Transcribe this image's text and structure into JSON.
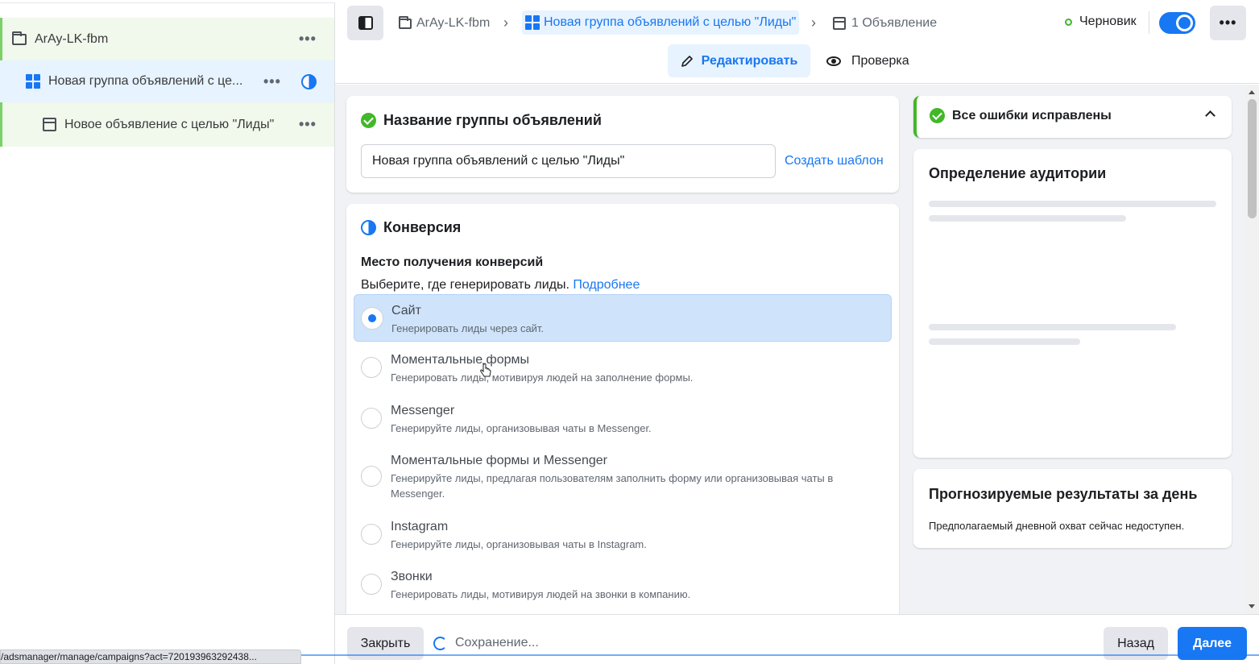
{
  "tree": {
    "campaign": {
      "label": "ArAy-LK-fbm",
      "more": "•••"
    },
    "adset": {
      "label": "Новая группа объявлений с це...",
      "more": "•••"
    },
    "ad": {
      "label": "Новое объявление с целью \"Лиды\"",
      "more": "•••"
    }
  },
  "header": {
    "breadcrumbs": [
      {
        "label": "ArAy-LK-fbm"
      },
      {
        "label": "Новая группа объявлений с целью \"Лиды\""
      },
      {
        "label": "1 Объявление"
      }
    ],
    "status": "Черновик",
    "more": "•••",
    "tabs": {
      "edit": "Редактировать",
      "review": "Проверка"
    }
  },
  "adset_name_card": {
    "title": "Название группы объявлений",
    "input_value": "Новая группа объявлений с целью \"Лиды\"",
    "create_template": "Создать шаблон"
  },
  "conversion_card": {
    "title": "Конверсия",
    "subhead": "Место получения конверсий",
    "subtext": "Выберите, где генерировать лиды.",
    "more_link": "Подробнее",
    "options": [
      {
        "title": "Сайт",
        "desc": "Генерировать лиды через сайт.",
        "selected": true
      },
      {
        "title": "Моментальные формы",
        "desc": "Генерировать лиды, мотивируя людей на заполнение формы.",
        "selected": false
      },
      {
        "title": "Messenger",
        "desc": "Генерируйте лиды, организовывая чаты в Messenger.",
        "selected": false
      },
      {
        "title": "Моментальные формы и Messenger",
        "desc": "Генерируйте лиды, предлагая пользователям заполнить форму или организовывая чаты в Messenger.",
        "selected": false
      },
      {
        "title": "Instagram",
        "desc": "Генерируйте лиды, организовывая чаты в Instagram.",
        "selected": false
      },
      {
        "title": "Звонки",
        "desc": "Генерировать лиды, мотивируя людей на звонки в компанию.",
        "selected": false
      }
    ]
  },
  "side": {
    "errors_title": "Все ошибки исправлены",
    "audience_title": "Определение аудитории",
    "forecast_title": "Прогнозируемые результаты за день",
    "forecast_text": "Предполагаемый дневной охват сейчас недоступен."
  },
  "footer": {
    "close": "Закрыть",
    "saving": "Сохранение...",
    "back": "Назад",
    "next": "Далее"
  },
  "browser_status": "/adsmanager/manage/campaigns?act=720193963292438...",
  "colors": {
    "accent": "#1877f2",
    "success": "#42b72a",
    "selected_bg": "#cfe4fb"
  }
}
